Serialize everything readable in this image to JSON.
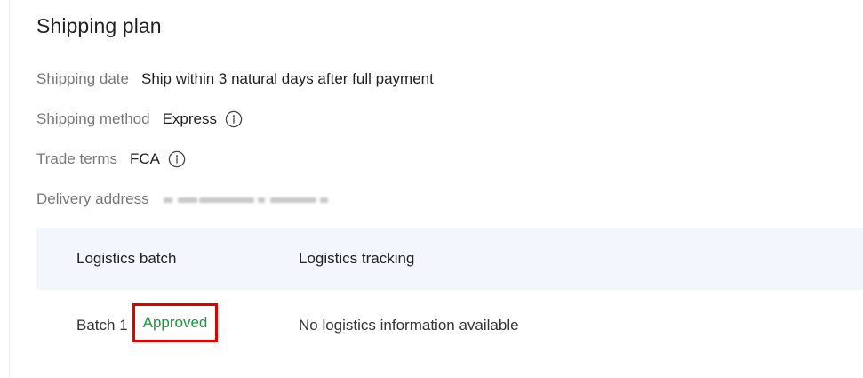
{
  "section": {
    "title": "Shipping plan"
  },
  "details": {
    "shipping_date": {
      "label": "Shipping date",
      "value": "Ship within 3 natural days after full payment"
    },
    "shipping_method": {
      "label": "Shipping method",
      "value": "Express",
      "icon": "info-icon"
    },
    "trade_terms": {
      "label": "Trade terms",
      "value": "FCA",
      "icon": "info-icon"
    },
    "delivery_address": {
      "label": "Delivery address"
    }
  },
  "table": {
    "columns": [
      "Logistics batch",
      "Logistics tracking"
    ],
    "rows": [
      {
        "batch": "Batch 1",
        "status": "Approved",
        "tracking": "No logistics information available"
      }
    ]
  },
  "colors": {
    "status_approved": "#1a9a3a",
    "highlight_box": "#e00000",
    "table_header_bg": "#f3f6fc"
  }
}
